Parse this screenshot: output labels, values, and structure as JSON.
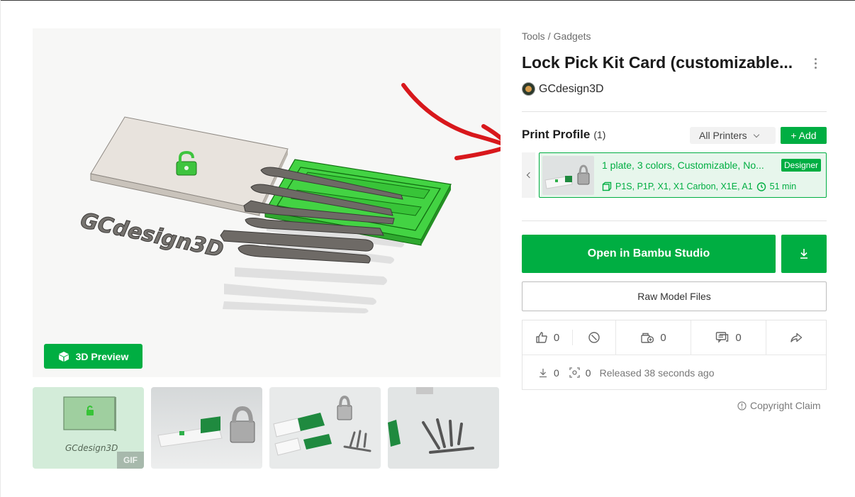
{
  "breadcrumb": {
    "category": "Tools",
    "separator": "/",
    "subcategory": "Gadgets"
  },
  "model": {
    "title": "Lock Pick Kit Card (customizable...",
    "author": "GCdesign3D",
    "more_icon": "kebab-icon"
  },
  "hero": {
    "watermark_text": "GCdesign3D"
  },
  "preview_button": {
    "label": "3D Preview",
    "icon": "cube-icon"
  },
  "thumbnails": [
    {
      "name": "thumb-gif",
      "caption": "GCdesign3D",
      "badge": "GIF",
      "selected": true
    },
    {
      "name": "thumb-photo-1"
    },
    {
      "name": "thumb-photo-2"
    },
    {
      "name": "thumb-photo-3"
    }
  ],
  "print_profile": {
    "heading": "Print Profile",
    "count": "(1)",
    "printer_filter": "All Printers",
    "add_label": "+ Add",
    "profiles": [
      {
        "name": "1 plate, 3 colors, Customizable, No...",
        "badge": "Designer",
        "printers": "P1S, P1P, X1, X1 Carbon, X1E, A1",
        "time": "51 min"
      }
    ]
  },
  "actions": {
    "open_label": "Open in Bambu Studio",
    "download_icon": "download-icon",
    "raw_label": "Raw Model Files"
  },
  "stats": {
    "likes": "0",
    "boosts": "0",
    "comments": "0",
    "downloads": "0",
    "prints": "0",
    "released": "Released 38 seconds ago"
  },
  "copyright_label": "Copyright Claim",
  "colors": {
    "accent": "#00ae42",
    "accent_light": "#e7f6ec",
    "arrow": "#d8181c"
  }
}
